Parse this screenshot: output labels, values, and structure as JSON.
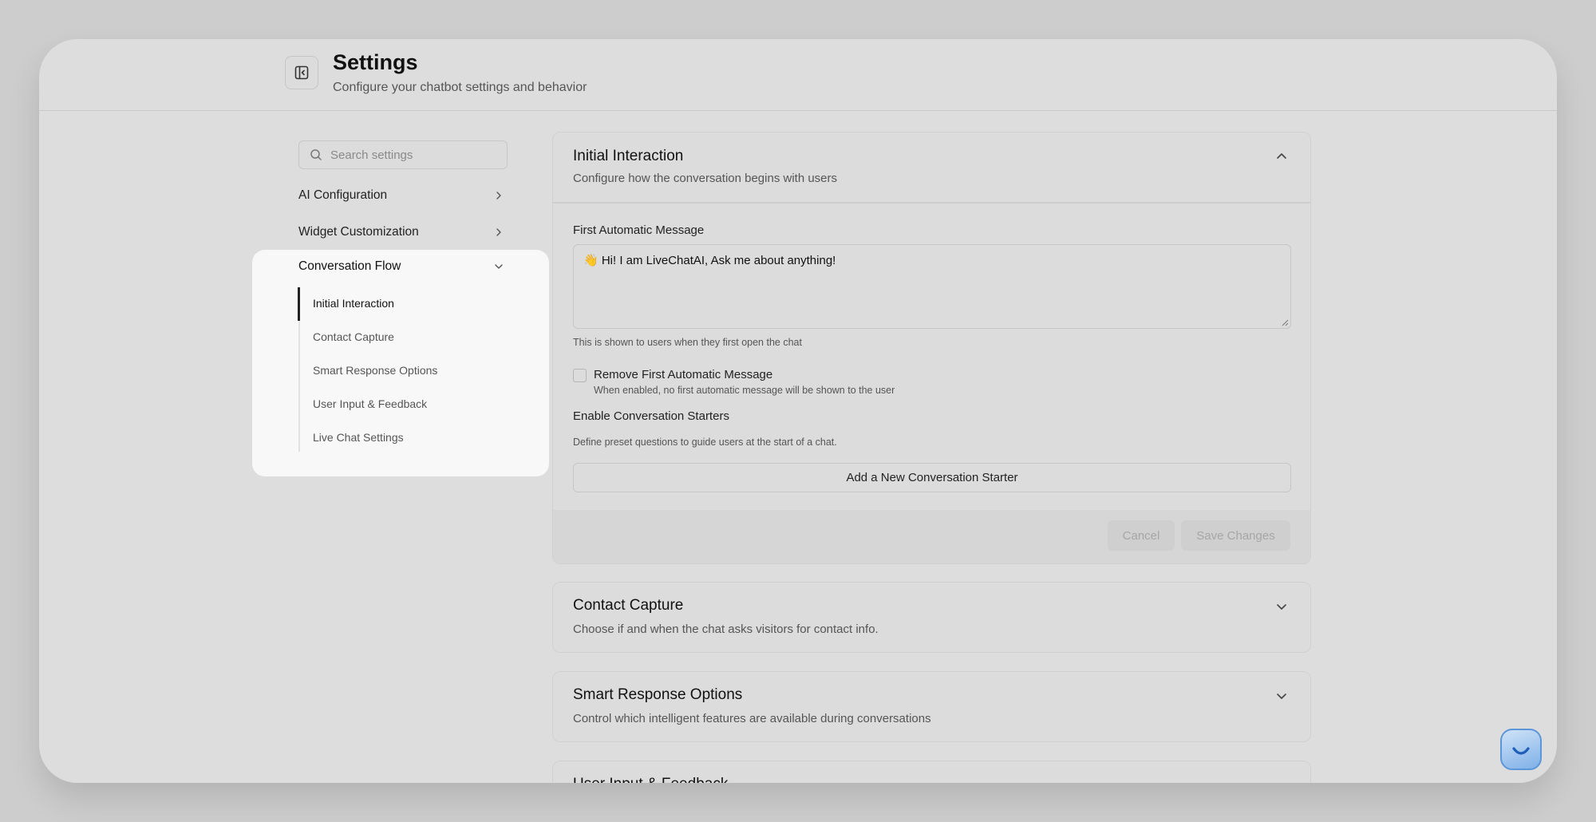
{
  "header": {
    "title": "Settings",
    "subtitle": "Configure your chatbot settings and behavior"
  },
  "sidebar": {
    "search_placeholder": "Search settings",
    "items": [
      {
        "label": "AI Configuration",
        "expanded": false
      },
      {
        "label": "Widget Customization",
        "expanded": false
      },
      {
        "label": "Conversation Flow",
        "expanded": true
      }
    ],
    "sub_items": [
      {
        "label": "Initial Interaction",
        "active": true
      },
      {
        "label": "Contact Capture",
        "active": false
      },
      {
        "label": "Smart Response Options",
        "active": false
      },
      {
        "label": "User Input & Feedback",
        "active": false
      },
      {
        "label": "Live Chat Settings",
        "active": false
      }
    ]
  },
  "initial_interaction": {
    "title": "Initial Interaction",
    "description": "Configure how the conversation begins with users",
    "first_message_label": "First Automatic Message",
    "first_message_value": "👋 Hi! I am LiveChatAI, Ask me about anything!",
    "first_message_hint": "This is shown to users when they first open the chat",
    "remove_label": "Remove First Automatic Message",
    "remove_hint": "When enabled, no first automatic message will be shown to the user",
    "remove_checked": false,
    "starters_label": "Enable Conversation Starters",
    "starters_hint": "Define preset questions to guide users at the start of a chat.",
    "add_starter_label": "Add a New Conversation Starter",
    "cancel_label": "Cancel",
    "save_label": "Save Changes"
  },
  "contact_capture": {
    "title": "Contact Capture",
    "description": "Choose if and when the chat asks visitors for contact info."
  },
  "smart_response": {
    "title": "Smart Response Options",
    "description": "Control which intelligent features are available during conversations"
  },
  "user_input": {
    "title": "User Input & Feedback"
  },
  "chat_widget": {
    "icon": "smile-icon"
  }
}
